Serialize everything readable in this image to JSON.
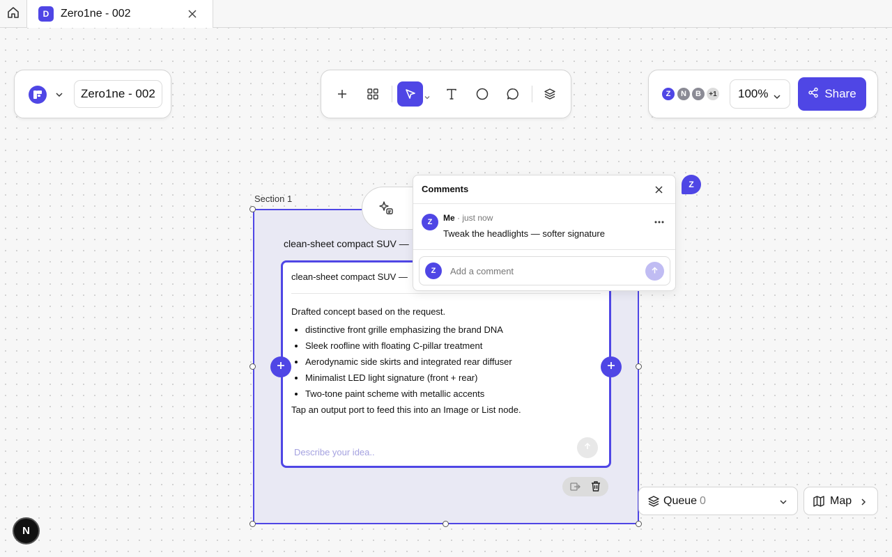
{
  "tab": {
    "badge": "D",
    "title": "Zero1ne - 002"
  },
  "project": {
    "name": "Zero1ne - 002"
  },
  "toolbar": {
    "tools": [
      "add-icon",
      "grid-icon",
      "pointer-icon",
      "text-icon",
      "circle-icon",
      "comment-icon",
      "layers-icon"
    ],
    "active_tool": "pointer-icon"
  },
  "collaborators": {
    "avatars": [
      {
        "initial": "Z",
        "color": "#4f46e5"
      },
      {
        "initial": "N",
        "color": "#8b8b95"
      },
      {
        "initial": "B",
        "color": "#8b8b95"
      }
    ],
    "more": "+1"
  },
  "zoom": {
    "value": "100%"
  },
  "share": {
    "label": "Share"
  },
  "section": {
    "label": "Section 1",
    "node_title": "clean-sheet compact SUV —"
  },
  "node": {
    "header": "clean-sheet compact SUV —",
    "intro": "Drafted concept based on the request.",
    "bullets": [
      "distinctive front grille emphasizing the brand DNA",
      "Sleek roofline with floating C-pillar treatment",
      "Aerodynamic side skirts and integrated rear diffuser",
      "Minimalist LED light signature (front + rear)",
      "Two-tone paint scheme with metallic accents"
    ],
    "tail": "Tap an output port to feed this into an Image or List node.",
    "input_placeholder": "Describe your idea.."
  },
  "comments": {
    "title": "Comments",
    "entries": [
      {
        "avatar": "Z",
        "author": "Me",
        "time": "· just now",
        "text": "Tweak the headlights — softer signature"
      }
    ],
    "input_avatar": "Z",
    "input_placeholder": "Add a comment",
    "cursor_tag": "Z"
  },
  "queue": {
    "label": "Queue",
    "count": "0"
  },
  "map": {
    "label": "Map"
  },
  "corner_badge": "N",
  "colors": {
    "accent": "#4f46e5",
    "section_fill": "#e9e9f4"
  }
}
